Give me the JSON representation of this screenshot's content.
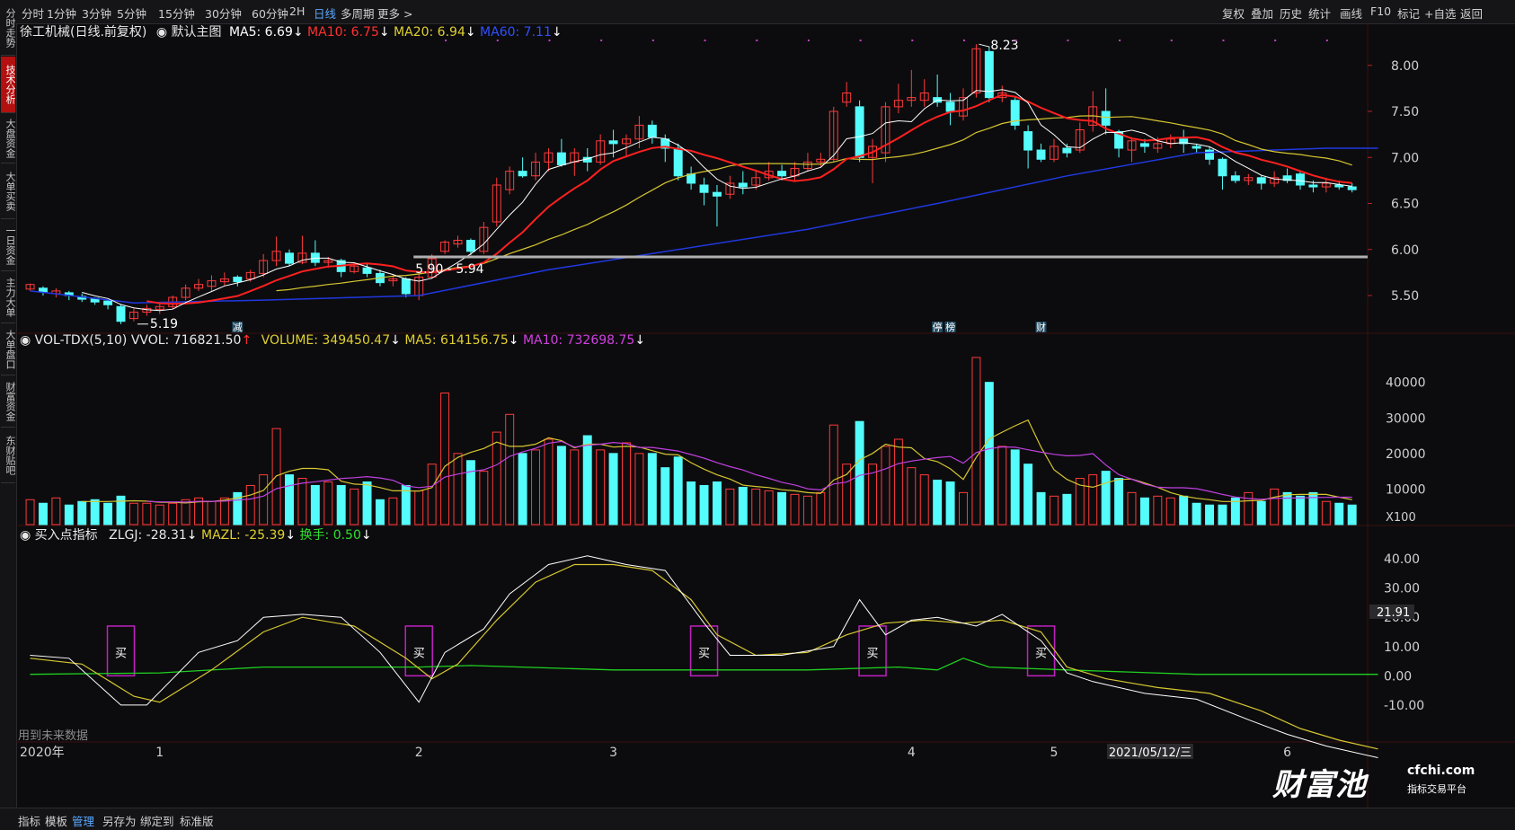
{
  "sidebar": {
    "tabs": [
      "分时走势",
      "技术分析",
      "大盘资金",
      "大单买卖",
      "一日资金",
      "主力大单",
      "大单盘口",
      "财富资金",
      "东财贴吧"
    ],
    "active": 1
  },
  "toolbar": {
    "periods": [
      "分时",
      "1分钟",
      "3分钟",
      "5分钟",
      "15分钟",
      "30分钟",
      "60分钟",
      "2H",
      "日线",
      "多周期",
      "更多 >"
    ],
    "active_period": "日线",
    "right": [
      "复权",
      "叠加",
      "历史",
      "统计",
      "画线",
      "F10",
      "标记",
      "+自选",
      "返回"
    ]
  },
  "price_header": {
    "stock": "徐工机械(日线.前复权)",
    "main": "默认主图",
    "ma5": "MA5: 6.69",
    "ma10": "MA10: 6.75",
    "ma20": "MA20: 6.94",
    "ma60": "MA60: 7.11"
  },
  "vol_header": {
    "name": "VOL-TDX(5,10)",
    "vvol": "VVOL: 716821.50",
    "volume": "VOLUME: 349450.47",
    "ma5": "MA5: 614156.75",
    "ma10": "MA10: 732698.75"
  },
  "ind_header": {
    "name": "买入点指标",
    "zlgj": "ZLGJ: -28.31",
    "mazl": "MAZL: -25.39",
    "hs": "换手: 0.50"
  },
  "bottom": {
    "tabs": [
      "指标",
      "模板",
      "管理",
      "另存为",
      "绑定到",
      "标准版"
    ],
    "active": "管理",
    "note": "用到未来数据"
  },
  "colors": {
    "up": "#ff3a3a",
    "down": "#54fcfc",
    "ma5": "#ffffff",
    "ma10": "#ff2020",
    "ma20": "#d6c631",
    "ma60": "#2038e0",
    "vma10": "#c040e0",
    "green": "#20d020",
    "buy": "#c020c0"
  },
  "watermark": {
    "brand": "财富池",
    "site": "cfchi.com",
    "slogan": "指标交易平台"
  },
  "chart_data": {
    "type": "candlestick",
    "price_axis": {
      "ticks": [
        8.0,
        7.5,
        7.0,
        6.5,
        6.0,
        5.5
      ],
      "ylim": [
        5.1,
        8.3
      ]
    },
    "annotations": {
      "high": "8.23",
      "low": "5.19",
      "band": "5.90 - 5.94",
      "band_value": 5.92
    },
    "x_labels": [
      {
        "label": "2020年",
        "i": 0
      },
      {
        "label": "1",
        "i": 10
      },
      {
        "label": "2",
        "i": 30
      },
      {
        "label": "3",
        "i": 45
      },
      {
        "label": "4",
        "i": 68
      },
      {
        "label": "5",
        "i": 79
      },
      {
        "label": "6",
        "i": 97
      }
    ],
    "cursor_date": "2021/05/12/三",
    "event_marks": [
      {
        "label": "减",
        "i": 16
      },
      {
        "label": "停",
        "i": 70
      },
      {
        "label": "榜",
        "i": 71
      },
      {
        "label": "财",
        "i": 78
      }
    ],
    "candles": [
      [
        5.57,
        5.62,
        5.63,
        5.55,
        7000
      ],
      [
        5.58,
        5.54,
        5.6,
        5.5,
        6000
      ],
      [
        5.52,
        5.55,
        5.58,
        5.48,
        7500
      ],
      [
        5.53,
        5.5,
        5.55,
        5.45,
        5500
      ],
      [
        5.49,
        5.46,
        5.52,
        5.43,
        6500
      ],
      [
        5.47,
        5.43,
        5.48,
        5.4,
        7000
      ],
      [
        5.44,
        5.4,
        5.45,
        5.35,
        6000
      ],
      [
        5.38,
        5.22,
        5.4,
        5.19,
        8000
      ],
      [
        5.25,
        5.32,
        5.36,
        5.22,
        6000
      ],
      [
        5.32,
        5.36,
        5.4,
        5.28,
        6000
      ],
      [
        5.35,
        5.38,
        5.42,
        5.3,
        5500
      ],
      [
        5.38,
        5.48,
        5.5,
        5.35,
        6000
      ],
      [
        5.48,
        5.58,
        5.62,
        5.45,
        7000
      ],
      [
        5.58,
        5.62,
        5.68,
        5.55,
        7500
      ],
      [
        5.6,
        5.66,
        5.72,
        5.55,
        6500
      ],
      [
        5.65,
        5.68,
        5.75,
        5.6,
        7500
      ],
      [
        5.7,
        5.65,
        5.72,
        5.6,
        9000
      ],
      [
        5.68,
        5.75,
        5.78,
        5.65,
        11000
      ],
      [
        5.74,
        5.88,
        5.95,
        5.7,
        14000
      ],
      [
        5.88,
        5.98,
        6.14,
        5.82,
        27000
      ],
      [
        5.96,
        5.85,
        6.0,
        5.82,
        14000
      ],
      [
        5.86,
        5.96,
        6.15,
        5.84,
        13000
      ],
      [
        5.96,
        5.86,
        6.1,
        5.82,
        11000
      ],
      [
        5.86,
        5.88,
        5.92,
        5.8,
        12000
      ],
      [
        5.88,
        5.76,
        5.9,
        5.7,
        11000
      ],
      [
        5.76,
        5.82,
        5.86,
        5.74,
        10000
      ],
      [
        5.8,
        5.74,
        5.84,
        5.7,
        12000
      ],
      [
        5.74,
        5.64,
        5.78,
        5.6,
        7000
      ],
      [
        5.66,
        5.68,
        5.72,
        5.6,
        7500
      ],
      [
        5.68,
        5.52,
        5.7,
        5.48,
        11000
      ],
      [
        5.5,
        5.7,
        5.75,
        5.45,
        9500
      ],
      [
        5.7,
        5.9,
        5.95,
        5.68,
        17000
      ],
      [
        5.98,
        6.08,
        6.1,
        5.95,
        37000
      ],
      [
        6.06,
        6.1,
        6.15,
        6.02,
        20000
      ],
      [
        6.1,
        5.98,
        6.12,
        5.94,
        18000
      ],
      [
        5.98,
        6.24,
        6.3,
        5.95,
        15000
      ],
      [
        6.3,
        6.7,
        6.78,
        6.25,
        26000
      ],
      [
        6.65,
        6.85,
        6.9,
        6.6,
        31000
      ],
      [
        6.85,
        6.8,
        7.0,
        6.78,
        20000
      ],
      [
        6.8,
        6.95,
        7.05,
        6.75,
        21000
      ],
      [
        6.95,
        7.05,
        7.1,
        6.85,
        24000
      ],
      [
        7.05,
        6.92,
        7.2,
        6.9,
        22000
      ],
      [
        6.95,
        7.05,
        7.1,
        6.8,
        21000
      ],
      [
        7.0,
        6.95,
        7.1,
        6.85,
        25000
      ],
      [
        6.95,
        7.18,
        7.25,
        6.92,
        21000
      ],
      [
        7.18,
        7.15,
        7.3,
        7.0,
        20000
      ],
      [
        7.15,
        7.2,
        7.25,
        7.0,
        23000
      ],
      [
        7.2,
        7.35,
        7.45,
        7.1,
        20000
      ],
      [
        7.35,
        7.22,
        7.4,
        7.15,
        20000
      ],
      [
        7.2,
        7.1,
        7.25,
        6.95,
        16000
      ],
      [
        7.1,
        6.8,
        7.15,
        6.75,
        19000
      ],
      [
        6.82,
        6.72,
        6.9,
        6.65,
        12000
      ],
      [
        6.7,
        6.62,
        6.78,
        6.48,
        11000
      ],
      [
        6.62,
        6.58,
        6.7,
        6.25,
        12000
      ],
      [
        6.6,
        6.72,
        6.8,
        6.55,
        10000
      ],
      [
        6.72,
        6.68,
        6.85,
        6.6,
        10500
      ],
      [
        6.7,
        6.78,
        6.85,
        6.65,
        10000
      ],
      [
        6.78,
        6.85,
        6.95,
        6.75,
        9500
      ],
      [
        6.85,
        6.8,
        6.92,
        6.75,
        9000
      ],
      [
        6.8,
        6.88,
        6.95,
        6.75,
        8500
      ],
      [
        6.88,
        6.95,
        7.05,
        6.85,
        8000
      ],
      [
        6.95,
        6.98,
        7.05,
        6.9,
        9000
      ],
      [
        6.98,
        7.5,
        7.55,
        6.95,
        28000
      ],
      [
        7.6,
        7.7,
        7.82,
        7.55,
        17000
      ],
      [
        7.55,
        7.0,
        7.62,
        6.95,
        29000
      ],
      [
        7.0,
        7.12,
        7.2,
        6.72,
        17000
      ],
      [
        7.05,
        7.55,
        7.6,
        6.95,
        22000
      ],
      [
        7.55,
        7.62,
        7.8,
        7.48,
        24000
      ],
      [
        7.62,
        7.65,
        7.95,
        7.55,
        16000
      ],
      [
        7.62,
        7.7,
        7.85,
        7.55,
        14000
      ],
      [
        7.65,
        7.6,
        7.9,
        7.55,
        12500
      ],
      [
        7.6,
        7.5,
        7.7,
        7.35,
        12000
      ],
      [
        7.45,
        7.65,
        7.75,
        7.4,
        9000
      ],
      [
        7.7,
        8.18,
        8.23,
        7.65,
        47000
      ],
      [
        8.15,
        7.65,
        8.2,
        7.6,
        40000
      ],
      [
        7.65,
        7.7,
        7.78,
        7.6,
        22000
      ],
      [
        7.62,
        7.35,
        7.65,
        7.3,
        21000
      ],
      [
        7.28,
        7.08,
        7.35,
        6.88,
        17000
      ],
      [
        7.08,
        6.98,
        7.15,
        6.95,
        9000
      ],
      [
        6.98,
        7.12,
        7.2,
        6.95,
        8000
      ],
      [
        7.1,
        7.05,
        7.15,
        7.0,
        8500
      ],
      [
        7.08,
        7.3,
        7.38,
        7.05,
        13000
      ],
      [
        7.35,
        7.55,
        7.72,
        7.28,
        14000
      ],
      [
        7.5,
        7.35,
        7.75,
        7.25,
        15000
      ],
      [
        7.28,
        7.1,
        7.3,
        7.0,
        13000
      ],
      [
        7.08,
        7.18,
        7.22,
        6.95,
        9000
      ],
      [
        7.15,
        7.12,
        7.2,
        7.05,
        7500
      ],
      [
        7.1,
        7.15,
        7.22,
        7.05,
        8000
      ],
      [
        7.15,
        7.2,
        7.25,
        7.1,
        7500
      ],
      [
        7.2,
        7.15,
        7.3,
        7.05,
        8000
      ],
      [
        7.12,
        7.1,
        7.15,
        7.05,
        6000
      ],
      [
        7.08,
        6.98,
        7.12,
        6.92,
        5500
      ],
      [
        6.98,
        6.8,
        7.0,
        6.65,
        5500
      ],
      [
        6.8,
        6.75,
        6.85,
        6.72,
        7500
      ],
      [
        6.75,
        6.78,
        6.82,
        6.7,
        9000
      ],
      [
        6.78,
        6.72,
        6.8,
        6.65,
        6500
      ],
      [
        6.72,
        6.78,
        6.85,
        6.68,
        10000
      ],
      [
        6.8,
        6.75,
        6.88,
        6.72,
        9000
      ],
      [
        6.82,
        6.7,
        6.85,
        6.65,
        8000
      ],
      [
        6.7,
        6.68,
        6.75,
        6.62,
        9000
      ],
      [
        6.68,
        6.72,
        6.78,
        6.62,
        6500
      ],
      [
        6.7,
        6.68,
        6.75,
        6.65,
        6000
      ],
      [
        6.68,
        6.65,
        6.72,
        6.62,
        5500
      ]
    ],
    "ma60_path": [
      [
        0,
        5.55
      ],
      [
        8,
        5.42
      ],
      [
        18,
        5.45
      ],
      [
        30,
        5.5
      ],
      [
        40,
        5.78
      ],
      [
        50,
        6.0
      ],
      [
        60,
        6.22
      ],
      [
        70,
        6.5
      ],
      [
        80,
        6.8
      ],
      [
        90,
        7.05
      ],
      [
        100,
        7.1
      ],
      [
        104,
        7.1
      ]
    ],
    "volume_axis": {
      "ticks": [
        40000,
        30000,
        20000,
        10000
      ],
      "unit": "X100",
      "ylim": [
        0,
        48000
      ]
    },
    "indicator": {
      "ticks": [
        40.0,
        30.0,
        20.0,
        10.0,
        0.0,
        -10.0
      ],
      "ylim": [
        -22,
        44
      ],
      "current": "21.91",
      "zlgj": [
        [
          0,
          7
        ],
        [
          3,
          6
        ],
        [
          7,
          -10
        ],
        [
          9,
          -10
        ],
        [
          13,
          8
        ],
        [
          16,
          12
        ],
        [
          18,
          20
        ],
        [
          21,
          21
        ],
        [
          24,
          20
        ],
        [
          27,
          8
        ],
        [
          30,
          -9
        ],
        [
          32,
          8
        ],
        [
          35,
          16
        ],
        [
          37,
          28
        ],
        [
          40,
          38
        ],
        [
          43,
          41
        ],
        [
          46,
          38
        ],
        [
          49,
          36
        ],
        [
          52,
          18
        ],
        [
          54,
          7
        ],
        [
          58,
          7
        ],
        [
          62,
          10
        ],
        [
          64,
          26
        ],
        [
          66,
          14
        ],
        [
          68,
          19
        ],
        [
          70,
          20
        ],
        [
          73,
          17
        ],
        [
          75,
          21
        ],
        [
          78,
          12
        ],
        [
          80,
          1
        ],
        [
          82,
          -2
        ],
        [
          86,
          -6
        ],
        [
          90,
          -8
        ],
        [
          94,
          -15
        ],
        [
          97,
          -20
        ],
        [
          100,
          -24
        ],
        [
          104,
          -28
        ]
      ],
      "mazl": [
        [
          0,
          6
        ],
        [
          4,
          4
        ],
        [
          8,
          -7
        ],
        [
          10,
          -9
        ],
        [
          14,
          2
        ],
        [
          18,
          15
        ],
        [
          21,
          20
        ],
        [
          25,
          17
        ],
        [
          29,
          6
        ],
        [
          31,
          -1
        ],
        [
          33,
          4
        ],
        [
          36,
          19
        ],
        [
          39,
          32
        ],
        [
          42,
          38
        ],
        [
          45,
          38
        ],
        [
          48,
          36
        ],
        [
          51,
          26
        ],
        [
          53,
          14
        ],
        [
          56,
          7
        ],
        [
          60,
          8
        ],
        [
          63,
          14
        ],
        [
          66,
          18
        ],
        [
          69,
          19
        ],
        [
          72,
          18
        ],
        [
          75,
          19
        ],
        [
          78,
          15
        ],
        [
          80,
          3
        ],
        [
          83,
          -1
        ],
        [
          87,
          -4
        ],
        [
          91,
          -6
        ],
        [
          95,
          -12
        ],
        [
          98,
          -18
        ],
        [
          101,
          -22
        ],
        [
          104,
          -25
        ]
      ],
      "hs": [
        [
          0,
          0.5
        ],
        [
          10,
          1
        ],
        [
          18,
          3
        ],
        [
          30,
          3
        ],
        [
          34,
          3.5
        ],
        [
          45,
          2
        ],
        [
          60,
          2
        ],
        [
          67,
          3
        ],
        [
          70,
          2
        ],
        [
          72,
          6
        ],
        [
          74,
          3
        ],
        [
          80,
          2
        ],
        [
          90,
          0.5
        ],
        [
          104,
          0.5
        ]
      ],
      "buy_points": [
        {
          "label": "买",
          "i": 7
        },
        {
          "label": "买",
          "i": 30
        },
        {
          "label": "买",
          "i": 52
        },
        {
          "label": "买",
          "i": 65
        },
        {
          "label": "买",
          "i": 78
        }
      ]
    }
  }
}
